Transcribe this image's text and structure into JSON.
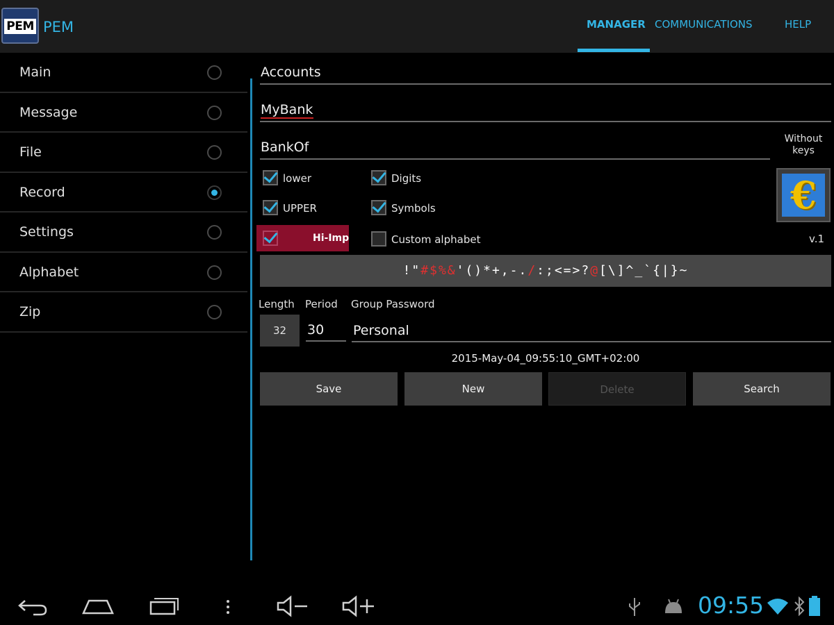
{
  "app": {
    "logo_text": "PEM",
    "title": "PEM"
  },
  "tabs": [
    {
      "label": "MANAGER",
      "selected": true
    },
    {
      "label": "COMMUNICATIONS",
      "selected": false
    },
    {
      "label": "HELP",
      "selected": false
    }
  ],
  "sidebar": {
    "items": [
      {
        "label": "Main",
        "selected": false
      },
      {
        "label": "Message",
        "selected": false
      },
      {
        "label": "File",
        "selected": false
      },
      {
        "label": "Record",
        "selected": true
      },
      {
        "label": "Settings",
        "selected": false
      },
      {
        "label": "Alphabet",
        "selected": false
      },
      {
        "label": "Zip",
        "selected": false
      }
    ]
  },
  "form": {
    "accounts": "Accounts",
    "account_name": "MyBank",
    "username": "BankOf",
    "checkboxes": {
      "lower": {
        "label": "lower",
        "checked": true
      },
      "upper": {
        "label": "UPPER",
        "checked": true
      },
      "hi_imp": {
        "label": "Hi-Imp",
        "checked": true
      },
      "digits": {
        "label": "Digits",
        "checked": true
      },
      "symbols": {
        "label": "Symbols",
        "checked": true
      },
      "custom_alphabet": {
        "label": "Custom alphabet",
        "checked": false
      }
    },
    "without_keys_line1": "Without",
    "without_keys_line2": "keys",
    "key_icon": "euro-icon",
    "version": "v.1",
    "alphabet": {
      "part1": "!\"",
      "red1": "#$%&",
      "part2": "'()*+,-.",
      "red2": "/",
      "part3": ":;<=>?",
      "red3": "@",
      "part4": "[\\]^_`{|}~"
    },
    "length_label": "Length",
    "length_value": "32",
    "period_label": "Period",
    "period_value": "30",
    "group_password_label": "Group Password",
    "group_password_value": "Personal",
    "timestamp": "2015-May-04_09:55:10_GMT+02:00"
  },
  "buttons": {
    "save": "Save",
    "new": "New",
    "delete": "Delete",
    "search": "Search"
  },
  "statusbar": {
    "time": "09:55"
  },
  "colors": {
    "accent": "#33b5e5",
    "hi_imp": "#8a0f2c",
    "alert_red": "#e03030"
  }
}
